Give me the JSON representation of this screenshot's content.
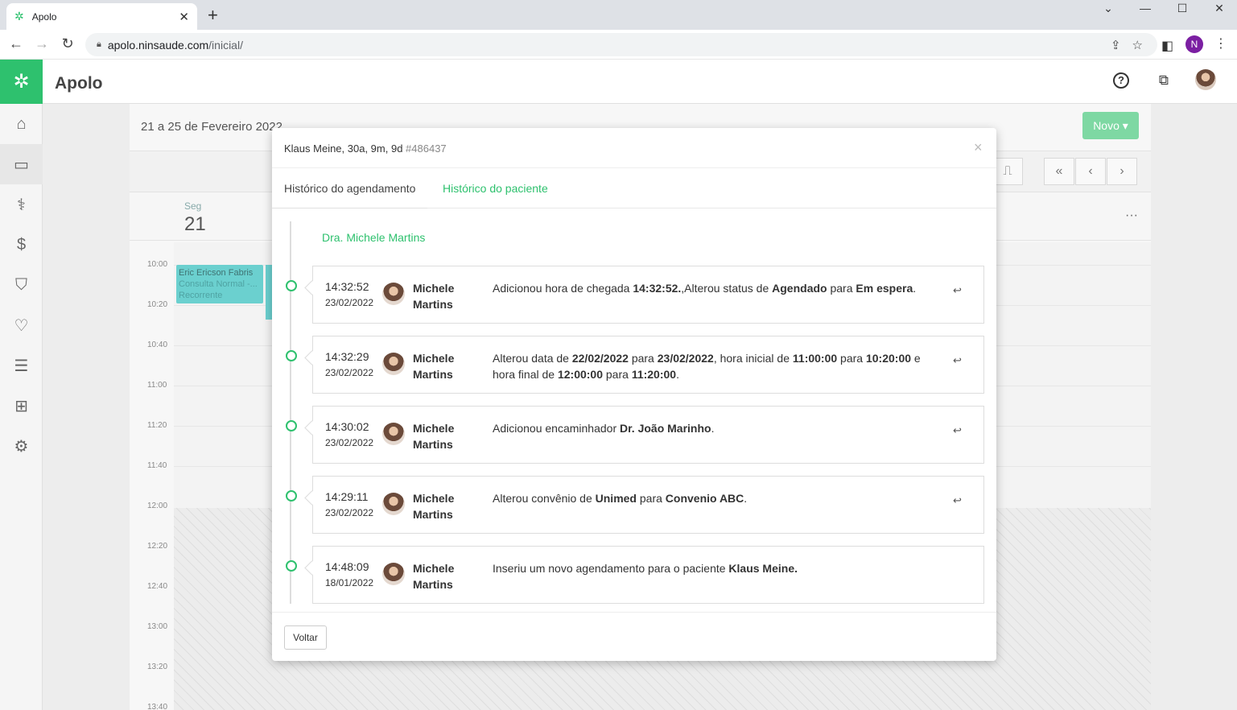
{
  "browser": {
    "tab_title": "Apolo",
    "url_host": "apolo.ninsaude.com",
    "url_path": "/inicial/",
    "profile_initial": "N"
  },
  "app": {
    "title": "Apolo",
    "brand_color": "#2ec16e"
  },
  "sidebar": {
    "items": [
      "home-icon",
      "calendar-icon",
      "stethoscope-icon",
      "dollar-icon",
      "bag-icon",
      "heartbeat-icon",
      "list-icon",
      "grid-icon",
      "gear-icon"
    ]
  },
  "calendar": {
    "range_title": "21 a 25 de Fevereiro 2022",
    "new_button": "Novo",
    "day_of_week": "Seg",
    "day_number": "21",
    "times": [
      "10:00",
      "10:20",
      "10:40",
      "11:00",
      "11:20",
      "11:40",
      "12:00",
      "12:20",
      "12:40",
      "13:00",
      "13:20",
      "13:40"
    ],
    "event": {
      "title": "Eric Ericson Fabris",
      "type": "Consulta Normal -...",
      "status": "Recorrente"
    }
  },
  "modal": {
    "patient": "Klaus Meine, 30a, 9m, 9d",
    "patient_id": "#486437",
    "tabs": [
      "Histórico do agendamento",
      "Histórico do paciente"
    ],
    "doctor": "Dra. Michele Martins",
    "entries": [
      {
        "time": "14:32:52",
        "date": "23/02/2022",
        "user": "Michele Martins",
        "parts": [
          [
            "Adicionou hora de chegada ",
            false
          ],
          [
            "14:32:52.",
            true
          ],
          [
            ",Alterou status de ",
            false
          ],
          [
            "Agendado",
            true
          ],
          [
            " para ",
            false
          ],
          [
            "Em espera",
            true
          ],
          [
            ".",
            false
          ]
        ]
      },
      {
        "time": "14:32:29",
        "date": "23/02/2022",
        "user": "Michele Martins",
        "parts": [
          [
            "Alterou data de ",
            false
          ],
          [
            "22/02/2022",
            true
          ],
          [
            " para ",
            false
          ],
          [
            "23/02/2022",
            true
          ],
          [
            ", hora inicial de ",
            false
          ],
          [
            "11:00:00",
            true
          ],
          [
            " para ",
            false
          ],
          [
            "10:20:00",
            true
          ],
          [
            " e hora final de ",
            false
          ],
          [
            "12:00:00",
            true
          ],
          [
            " para ",
            false
          ],
          [
            "11:20:00",
            true
          ],
          [
            ".",
            false
          ]
        ]
      },
      {
        "time": "14:30:02",
        "date": "23/02/2022",
        "user": "Michele Martins",
        "parts": [
          [
            "Adicionou encaminhador ",
            false
          ],
          [
            "Dr. João Marinho",
            true
          ],
          [
            ".",
            false
          ]
        ]
      },
      {
        "time": "14:29:11",
        "date": "23/02/2022",
        "user": "Michele Martins",
        "parts": [
          [
            "Alterou convênio de ",
            false
          ],
          [
            "Unimed",
            true
          ],
          [
            " para ",
            false
          ],
          [
            "Convenio ABC",
            true
          ],
          [
            ".",
            false
          ]
        ]
      },
      {
        "time": "14:48:09",
        "date": "18/01/2022",
        "user": "Michele Martins",
        "parts": [
          [
            "Inseriu um novo agendamento para o paciente ",
            false
          ],
          [
            "Klaus Meine.",
            true
          ]
        ]
      }
    ],
    "back_button": "Voltar"
  }
}
